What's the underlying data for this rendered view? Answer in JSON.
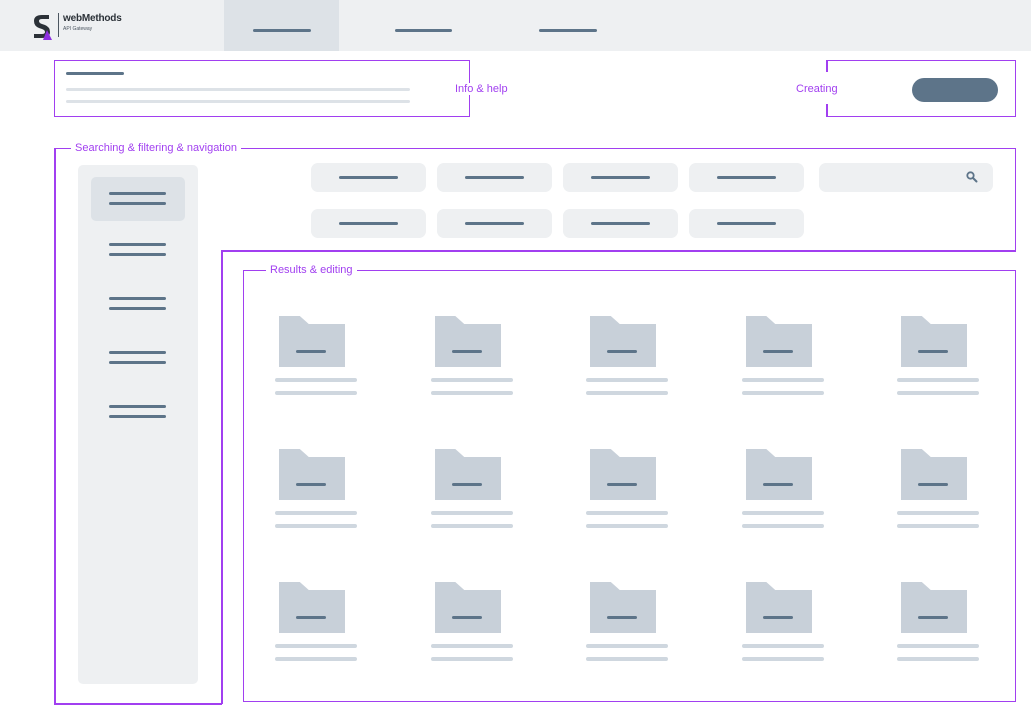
{
  "app": {
    "brand_name": "webMethods",
    "brand_sub": "API Gateway",
    "accent_color": "#a13ff0",
    "primary_color": "#5d7489",
    "neutral_bg": "#eef0f2"
  },
  "nav": {
    "tabs": [
      {
        "id": "tab-1",
        "active": true
      },
      {
        "id": "tab-2",
        "active": false
      },
      {
        "id": "tab-3",
        "active": false
      }
    ]
  },
  "zones": {
    "info": "Info & help",
    "creating": "Creating",
    "search": "Searching & filtering & navigation",
    "results": "Results & editing"
  },
  "icons": {
    "logo": "webmethods-logo-icon",
    "search": "search-icon",
    "folder": "folder-icon"
  },
  "sidebar": {
    "item_count": 5,
    "active_index": 0
  },
  "filters": {
    "chip_count": 8
  },
  "results": {
    "rows": 3,
    "columns": 5
  }
}
